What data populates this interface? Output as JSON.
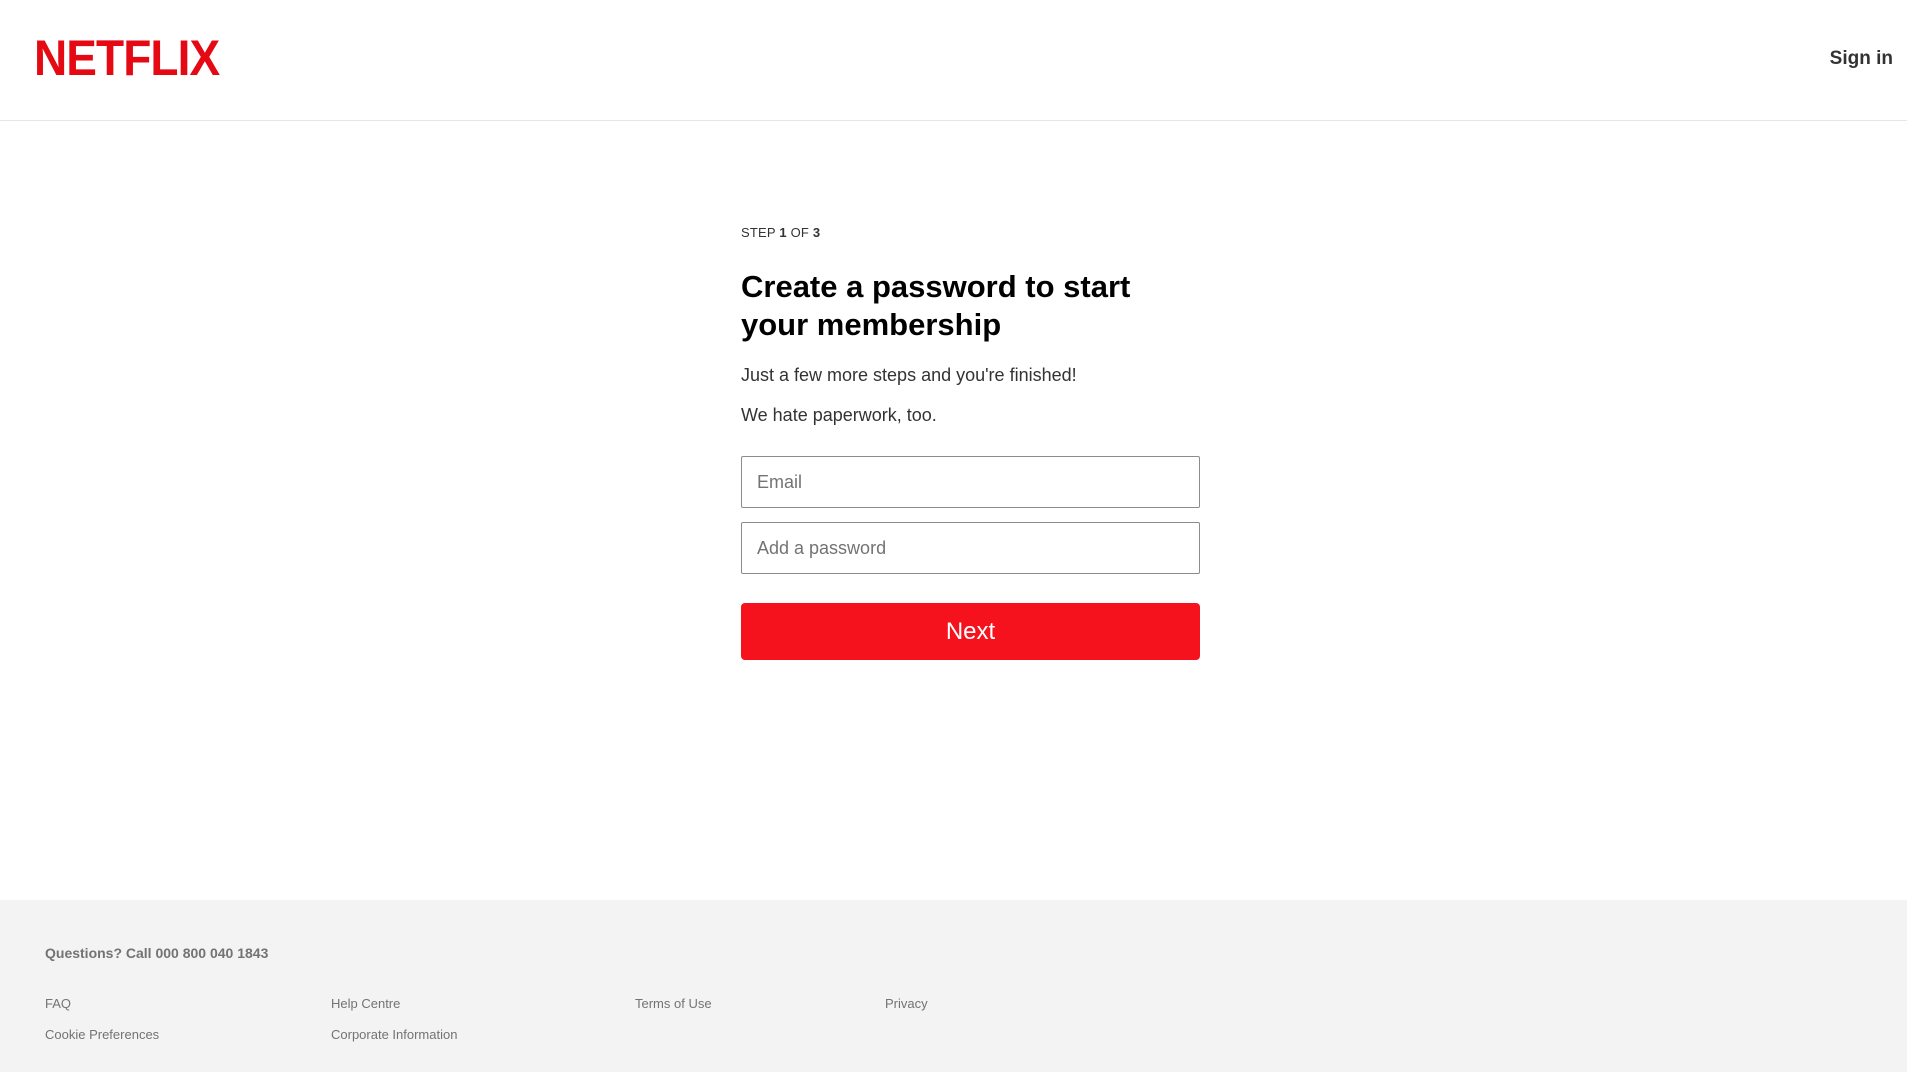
{
  "header": {
    "logo_text": "NETFLIX",
    "sign_in_label": "Sign in"
  },
  "main": {
    "step_prefix": "STEP ",
    "step_current": "1",
    "step_mid": " OF ",
    "step_total": "3",
    "title": "Create a password to start your membership",
    "subtitle_1": "Just a few more steps and you're finished!",
    "subtitle_2": "We hate paperwork, too.",
    "email_placeholder": "Email",
    "email_value": "",
    "password_placeholder": "Add a password",
    "password_value": "",
    "next_label": "Next"
  },
  "footer": {
    "questions": "Questions? Call 000 800 040 1843",
    "links": [
      "FAQ",
      "Help Centre",
      "Terms of Use",
      "Privacy",
      "Cookie Preferences",
      "Corporate Information"
    ]
  },
  "colors": {
    "brand_red": "#e50914",
    "button_red": "#f6121d",
    "footer_bg": "#f3f3f3",
    "footer_text": "#737373"
  }
}
